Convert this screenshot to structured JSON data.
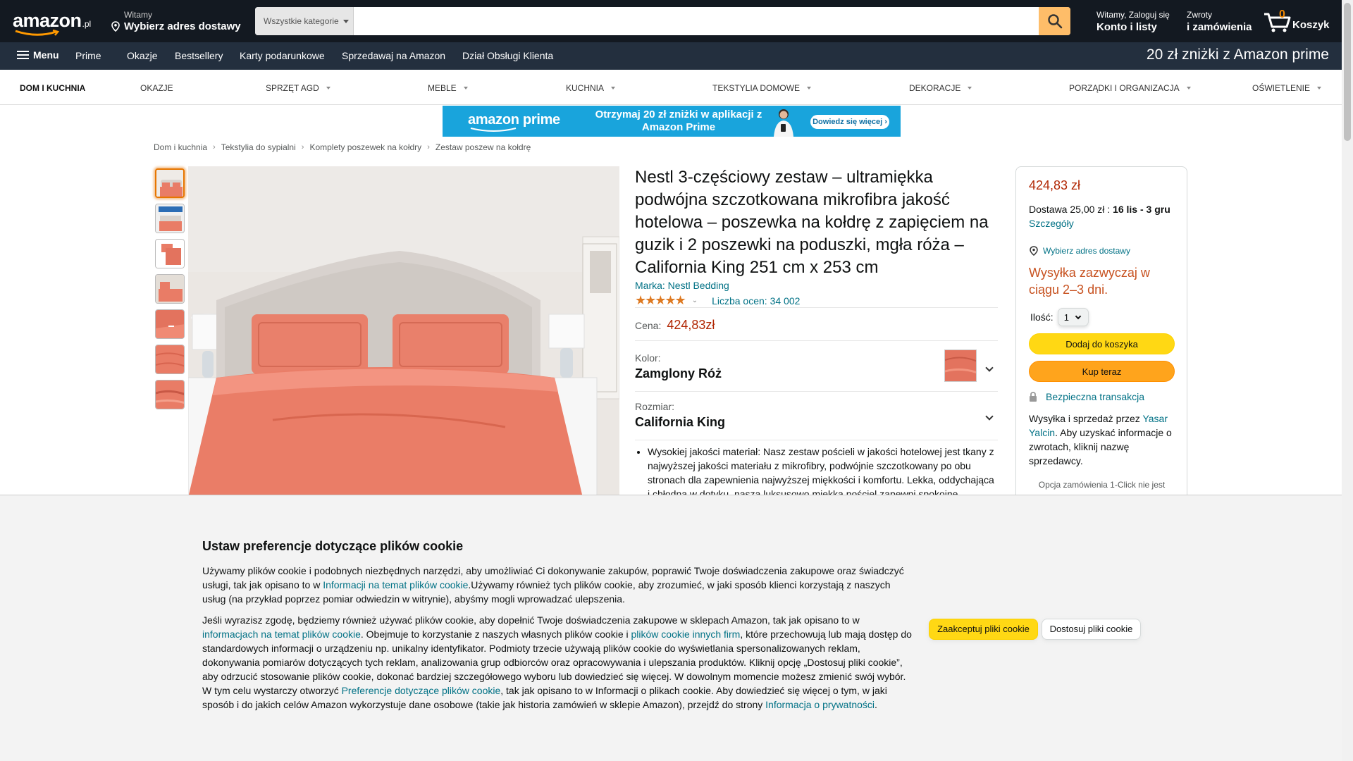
{
  "colors": {
    "nav_dark": "#131921",
    "nav_sub": "#232f3e",
    "search_button": "#febd69",
    "price": "#b12704",
    "link": "#007185",
    "shipping": "#c7511f",
    "add_to_cart": "#ffd814",
    "buy_now": "#ffa41c",
    "product_color": "#e37a66",
    "banner": "#19a4dc"
  },
  "header": {
    "logo_word": "amazon",
    "logo_tld": ".pl",
    "deliver_l1": "Witamy",
    "deliver_l2": "Wybierz adres dostawy",
    "search_category": "Wszystkie kategorie",
    "search_placeholder": "",
    "account_l1": "Witamy, Zaloguj się",
    "account_l2": "Konto i listy",
    "returns_l1": "Zwroty",
    "returns_l2": "i zamówienia",
    "cart_count": "0",
    "cart_label": "Koszyk"
  },
  "subnav": {
    "menu": "Menu",
    "links": [
      "Prime",
      "Okazje",
      "Bestsellery",
      "Karty podarunkowe",
      "Sprzedawaj na Amazon",
      "Dział Obsługi Klienta"
    ],
    "promo": "20 zł zniżki z Amazon prime"
  },
  "category_nav": [
    "DOM I KUCHNIA",
    "OKAZJE",
    "SPRZĘT AGD",
    "MEBLE",
    "KUCHNIA",
    "TEKSTYLIA DOMOWE",
    "DEKORACJE",
    "PORZĄDKI I ORGANIZACJA",
    "OŚWIETLENIE"
  ],
  "banner": {
    "brand": "amazon prime",
    "text": "Otrzymaj 20 zł zniżki w aplikacji z Amazon Prime",
    "cta": "Dowiedz się więcej ›"
  },
  "breadcrumbs": [
    "Dom i kuchnia",
    "Tekstylia do sypialni",
    "Komplety poszewek na kołdry",
    "Zestaw poszew na kołdrę"
  ],
  "product": {
    "title": "Nestl 3-częściowy zestaw – ultramiękka podwójna szczotkowana mikrofibra jakość hotelowa – poszewka na kołdrę z zapięciem na guzik i 2 poszewki na poduszki, mgła róża – California King 251 cm x 253 cm",
    "brand": "Marka: Nestl Bedding",
    "rating_stars": "★★★★★",
    "rating_value": 4.5,
    "rating_count": "Liczba ocen: 34 002",
    "price_label": "Cena:",
    "price": "424,83zł",
    "color_label": "Kolor:",
    "color_value": "Zamglony Róż",
    "size_label": "Rozmiar:",
    "size_value": "California King",
    "bullet_1": "Wysokiej jakości materiał: Nasz zestaw pościeli w jakości hotelowej jest tkany z najwyższej jakości materiału z mikrofibry, podwójnie szczotkowany po obu stronach dla zapewnienia najwyższej miękkości i komfortu. Lekka, oddychająca i chłodna w dotyku, nasza luksusowo miękka pościel zapewni spokojne"
  },
  "buybox": {
    "price": "424,83 zł",
    "delivery_prefix": "Dostawa 25,00 zł : ",
    "delivery_dates": "16 lis - 3 gru",
    "details": "Szczegóły",
    "address": "Wybierz adres dostawy",
    "shipping": "Wysyłka zazwyczaj w ciągu 2–3 dni.",
    "qty_label": "Ilość:",
    "qty_value": "1",
    "add_to_cart": "Dodaj do koszyka",
    "buy_now": "Kup teraz",
    "secure": "Bezpieczna transakcja",
    "seller_prefix": "Wysyłka i sprzedaż przez ",
    "seller_name": "Yasar Yalcin",
    "seller_suffix": ". Aby uzyskać informacje o zwrotach, kliknij nazwę sprzedawcy.",
    "oneclick": "Opcja zamówienia 1-Click nie jest"
  },
  "cookie": {
    "title": "Ustaw preferencje dotyczące plików cookie",
    "p1_a": "Używamy plików cookie i podobnych niezbędnych narzędzi, aby umożliwiać Ci dokonywanie zakupów, poprawić Twoje doświadczenia zakupowe oraz świadczyć usługi, tak jak opisano to w ",
    "p1_link": "Informacji na temat plików cookie",
    "p1_b": ".Używamy również tych plików cookie, aby zrozumieć, w jaki sposób klienci korzystają z naszych usług (na przykład poprzez pomiar odwiedzin w witrynie), abyśmy mogli wprowadzać ulepszenia.",
    "p2_a": "Jeśli wyrazisz zgodę, będziemy również używać plików cookie, aby dopełnić Twoje doświadczenia zakupowe w sklepach Amazon, tak jak opisano to w ",
    "p2_link1": "informacjach na temat plików cookie",
    "p2_b": ". Obejmuje to korzystanie z naszych własnych plików cookie i ",
    "p2_link2": "plików cookie innych firm",
    "p2_c": ", które przechowują lub mają dostęp do standardowych informacji o urządzeniu np. unikalny identyfikator. Podmioty trzecie używają plików cookie do wyświetlania spersonalizowanych reklam, dokonywania pomiarów dotyczących tych reklam, analizowania grup odbiorców oraz opracowywania i ulepszania produktów. Kliknij opcję „Dostosuj pliki cookie”, aby odrzucić stosowanie plików cookie, dokonać bardziej szczegółowego wyboru lub dowiedzieć się więcej. W dowolnym momencie możesz zmienić swój wybór. W tym celu wystarczy otworzyć ",
    "p2_link3": "Preferencje dotyczące plików cookie",
    "p2_d": ", tak jak opisano to w Informacji o plikach cookie. Aby dowiedzieć się więcej o tym, w jaki sposób i do jakich celów Amazon wykorzystuje dane osobowe (takie jak historia zamówień w sklepie Amazon), przejdź do strony ",
    "p2_link4": "Informacja o prywatności",
    "p2_e": ".",
    "accept": "Zaakceptuj pliki cookie",
    "customize": "Dostosuj pliki cookie"
  }
}
